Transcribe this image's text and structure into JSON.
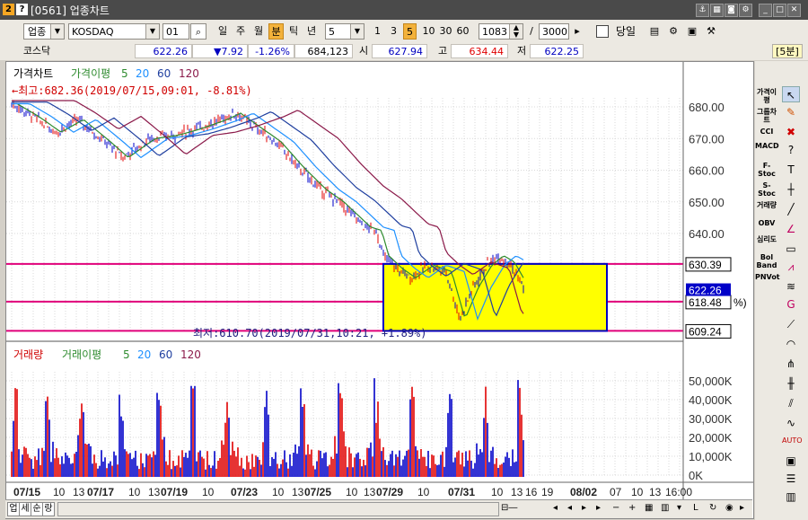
{
  "window": {
    "title": "[0561] 업종차트",
    "badge_a": "2",
    "badge_b": "?"
  },
  "toolbar": {
    "market_select": "업종",
    "index_name": "KOSDAQ",
    "index_code": "01",
    "period_buttons": [
      "일",
      "주",
      "월",
      "분",
      "틱",
      "년"
    ],
    "active_period": "분",
    "interval_value": "5",
    "interval_buttons": [
      "1",
      "3",
      "5",
      "10",
      "30",
      "60"
    ],
    "active_interval": "5",
    "count_value": "1083",
    "total_value": "3000",
    "separator": "/",
    "today_label": "당일"
  },
  "quote": {
    "name": "코스닥",
    "price": "622.26",
    "change": "▼7.92",
    "change_pct": "-1.26%",
    "volume": "684,123",
    "open_label": "시",
    "open": "627.94",
    "high_label": "고",
    "high": "634.44",
    "low_label": "저",
    "low": "622.25",
    "interval_tag": "[5분]"
  },
  "price_panel": {
    "legend_title": "가격차트",
    "legend_ma_label": "가격이평",
    "legend_periods": [
      "5",
      "20",
      "60",
      "120"
    ],
    "max_annotation": "←최고:682.36(2019/07/15,09:01, -8.81%)",
    "min_annotation": "최저:610.70(2019/07/31,10:21, +1.89%)",
    "price_ticks": [
      "680.00",
      "670.00",
      "660.00",
      "650.00",
      "640.00"
    ],
    "current_price_label": "622.26",
    "current_pct_label": "%)",
    "hlines": [
      {
        "value": "630.39"
      },
      {
        "value": "618.48"
      },
      {
        "value": "609.24"
      }
    ]
  },
  "volume_panel": {
    "legend_title": "거래량",
    "legend_ma_label": "거래이평",
    "legend_periods": [
      "5",
      "20",
      "60",
      "120"
    ],
    "volume_ticks": [
      "50,000K",
      "40,000K",
      "30,000K",
      "20,000K",
      "10,000K",
      "0K"
    ]
  },
  "x_axis": {
    "labels": [
      "07/15",
      "10",
      "13",
      "07/17",
      "10",
      "13",
      "07/19",
      "10",
      "07/23",
      "10",
      "13",
      "07/25",
      "10",
      "13",
      "07/29",
      "10",
      "07/31",
      "10",
      "13",
      "16",
      "19",
      "08/02",
      "07",
      "10",
      "13",
      "16:00"
    ]
  },
  "bottom": {
    "tabs": [
      "업",
      "세",
      "순",
      "랑"
    ]
  },
  "right_panel": {
    "indicators": [
      "가격이평",
      "그룹차트",
      "CCI",
      "MACD",
      "F-Stoc",
      "S-Stoc",
      "거래량",
      "OBV",
      "심리도",
      "Bol Band",
      "PNVot"
    ]
  },
  "colors": {
    "hline": "#e0007a",
    "box_fill": "#ffff00",
    "box_border": "#0000c0",
    "ma5": "#2e8b2e",
    "ma20": "#1e90ff",
    "ma60": "#1f3f9f",
    "ma120": "#8b1a4a",
    "up": "#e00000",
    "down": "#0000c8",
    "cursor_label_bg": "#0000c8"
  }
}
